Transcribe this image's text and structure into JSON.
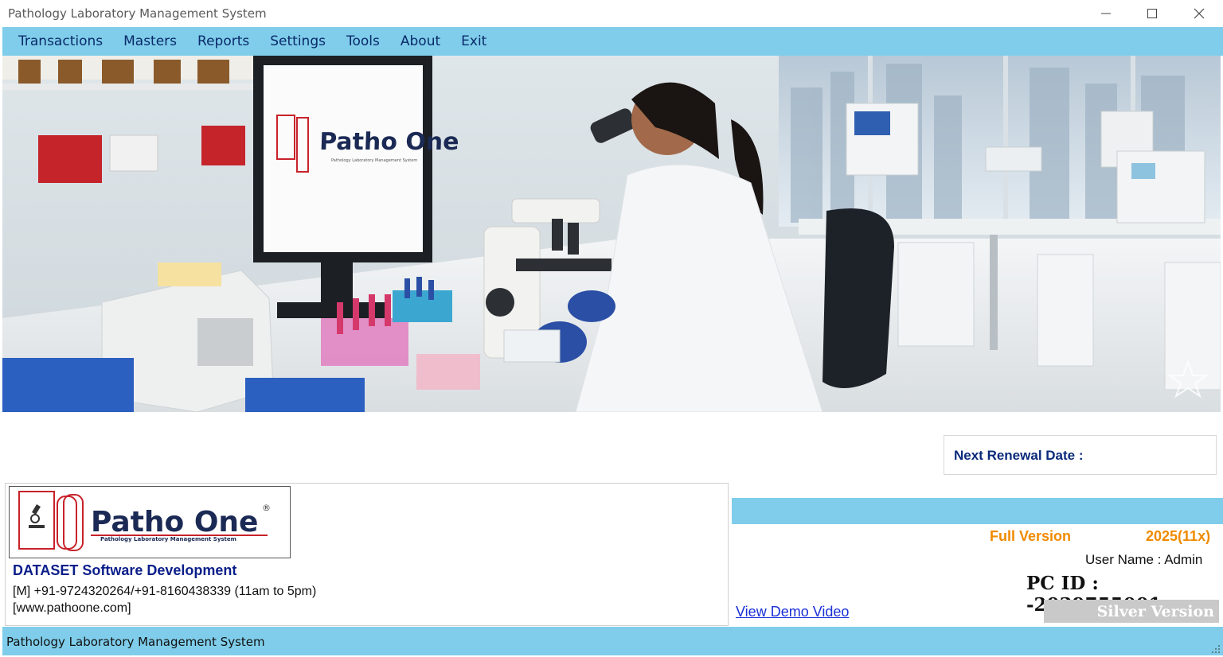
{
  "window": {
    "title": "Pathology Laboratory Management System",
    "controls": {
      "minimize": "minimize-icon",
      "maximize": "maximize-icon",
      "close": "close-icon"
    }
  },
  "menu": {
    "items": [
      {
        "label": "Transactions"
      },
      {
        "label": "Masters"
      },
      {
        "label": "Reports"
      },
      {
        "label": "Settings"
      },
      {
        "label": "Tools"
      },
      {
        "label": "About"
      },
      {
        "label": "Exit"
      }
    ]
  },
  "banner": {
    "monitor_brand": "Patho One",
    "monitor_tagline": "Pathology Laboratory Management System"
  },
  "renewal": {
    "label": "Next Renewal Date :",
    "value": ""
  },
  "company": {
    "logo_text": "Patho One",
    "logo_registered": "®",
    "logo_tagline": "Pathology Laboratory Management System",
    "name": "DATASET Software Development",
    "phone": "[M] +91-9724320264/+91-8160438339 (11am to 5pm)",
    "website": "[www.pathoone.com]"
  },
  "license": {
    "edition": "Full Version",
    "year": "2025(11x)",
    "user_label": "User Name",
    "user_name": "Admin",
    "user_text": "User Name  :  Admin",
    "pc_id": "PC ID : -2039755001",
    "demo_link": "View Demo Video",
    "badge": "Silver Version"
  },
  "status": {
    "text": "Pathology Laboratory Management System"
  },
  "colors": {
    "bar_blue": "#7fcdea",
    "menu_text": "#0a2a6a",
    "company_blue": "#0a1e8a",
    "version_orange": "#f08a00",
    "badge_gray": "#c9c9c9",
    "link_blue": "#1a2fd6",
    "logo_red": "#c8222a"
  }
}
